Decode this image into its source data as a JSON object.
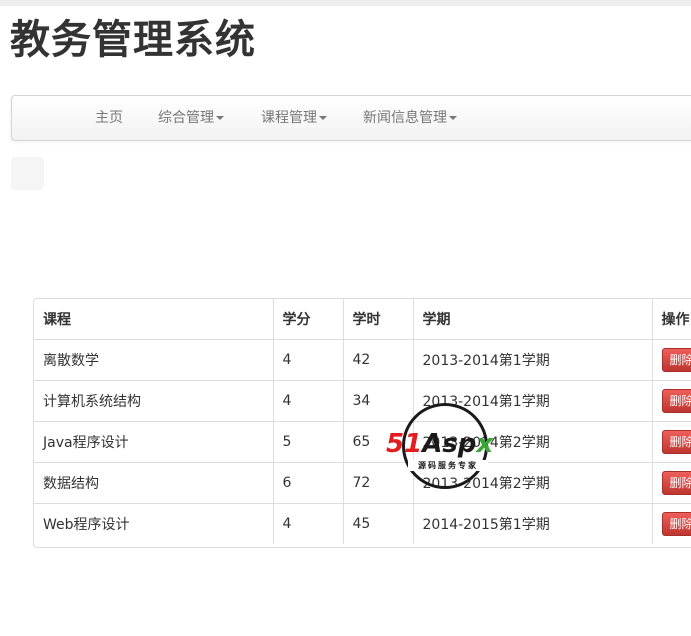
{
  "header": {
    "title": "教务管理系统"
  },
  "navbar": {
    "items": [
      {
        "label": "主页",
        "dropdown": false
      },
      {
        "label": "综合管理",
        "dropdown": true
      },
      {
        "label": "课程管理",
        "dropdown": true
      },
      {
        "label": "新闻信息管理",
        "dropdown": true
      }
    ]
  },
  "table": {
    "headers": [
      "课程",
      "学分",
      "学时",
      "学期",
      "操作"
    ],
    "delete_label": "删除",
    "rows": [
      {
        "course": "离散数学",
        "credit": "4",
        "hours": "42",
        "term": "2013-2014第1学期"
      },
      {
        "course": "计算机系统结构",
        "credit": "4",
        "hours": "34",
        "term": "2013-2014第1学期"
      },
      {
        "course": "Java程序设计",
        "credit": "5",
        "hours": "65",
        "term": "2013-2014第2学期"
      },
      {
        "course": "数据结构",
        "credit": "6",
        "hours": "72",
        "term": "2013-2014第2学期"
      },
      {
        "course": "Web程序设计",
        "credit": "4",
        "hours": "45",
        "term": "2014-2015第1学期"
      }
    ]
  },
  "watermark": {
    "brand_num": "51",
    "brand_word": "Asp",
    "brand_x": "x",
    "tagline": "源码服务专家"
  },
  "colors": {
    "danger": "#da4f49",
    "nav_text": "#777777",
    "title": "#333333"
  }
}
